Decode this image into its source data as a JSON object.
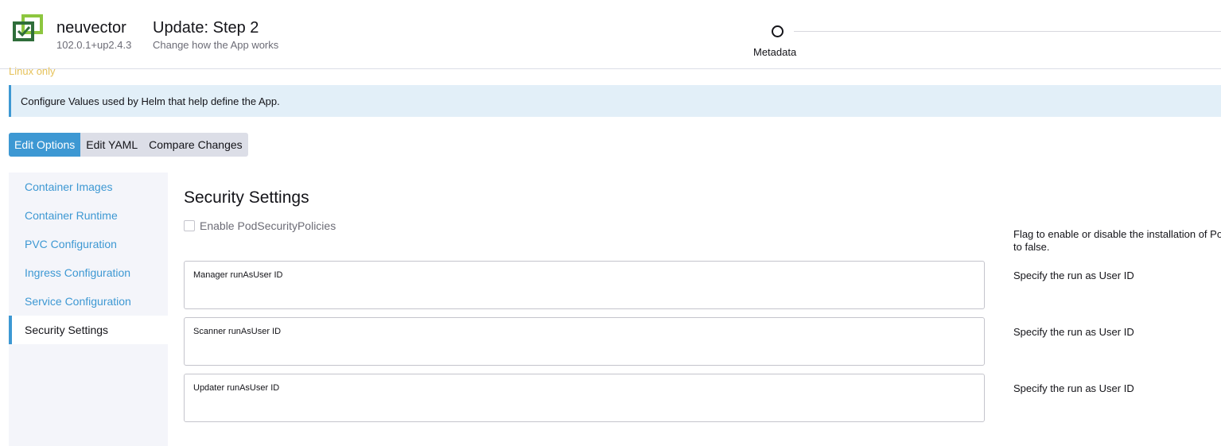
{
  "app": {
    "name": "neuvector",
    "version": "102.0.1+up2.4.3"
  },
  "header": {
    "title": "Update: Step 2",
    "subtitle": "Change how the App works"
  },
  "stepper": {
    "label": "Metadata"
  },
  "os_note": "Linux only",
  "banner": {
    "text": "Configure Values used by Helm that help define the App."
  },
  "tabs": [
    {
      "label": "Edit Options",
      "active": true
    },
    {
      "label": "Edit YAML",
      "active": false
    },
    {
      "label": "Compare Changes",
      "active": false
    }
  ],
  "sidenav": {
    "items": [
      {
        "label": "Container Images"
      },
      {
        "label": "Container Runtime"
      },
      {
        "label": "PVC Configuration"
      },
      {
        "label": "Ingress Configuration"
      },
      {
        "label": "Service Configuration"
      },
      {
        "label": "Security Settings",
        "active": true
      }
    ]
  },
  "section": {
    "title": "Security Settings",
    "checkbox": {
      "label": "Enable PodSecurityPolicies",
      "checked": false,
      "description_line1": "Flag to enable or disable the installation of PodSecurityPolicies by this chart, set",
      "description_line2": "to false."
    },
    "fields": [
      {
        "label": "Manager runAsUser ID",
        "value": "",
        "description": "Specify the run as User ID"
      },
      {
        "label": "Scanner runAsUser ID",
        "value": "",
        "description": "Specify the run as User ID"
      },
      {
        "label": "Updater runAsUser ID",
        "value": "",
        "description": "Specify the run as User ID"
      }
    ]
  },
  "colors": {
    "accent": "#3d98d3",
    "banner_bg": "#e2eff8",
    "logo_dark": "#2f6e3a",
    "logo_light": "#8dc63f",
    "warning_text": "#e6c25a"
  }
}
